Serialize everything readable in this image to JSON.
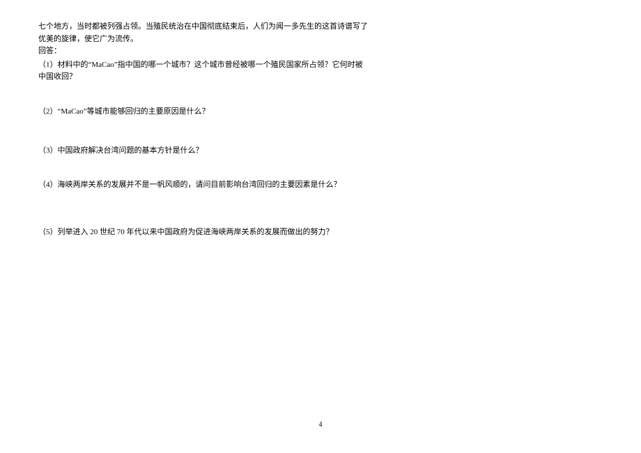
{
  "intro": {
    "line1": "七个地方，当时都被列强占领。当殖民统治在中国彻底结束后，人们为闻一多先生的这首诗谱写了",
    "line2": "优美的旋律，使它广为流传。",
    "line3": "回答："
  },
  "questions": {
    "q1_line1": "（1）材料中的“MaCao”指中国的哪一个城市？这个城市曾经被哪一个殖民国家所占领？它何时被",
    "q1_line2": "中国收回？",
    "q2": "（2）“MaCao”等城市能够回归的主要原因是什么？",
    "q3": "（3）中国政府解决台湾问题的基本方针是什么？",
    "q4": "（4）海峡两岸关系的发展并不是一帆风顺的，请问目前影响台湾回归的主要因素是什么？",
    "q5": "（5）列举进入 20 世纪 70 年代以来中国政府为促进海峡两岸关系的发展而做出的努力？"
  },
  "page_number": "4"
}
